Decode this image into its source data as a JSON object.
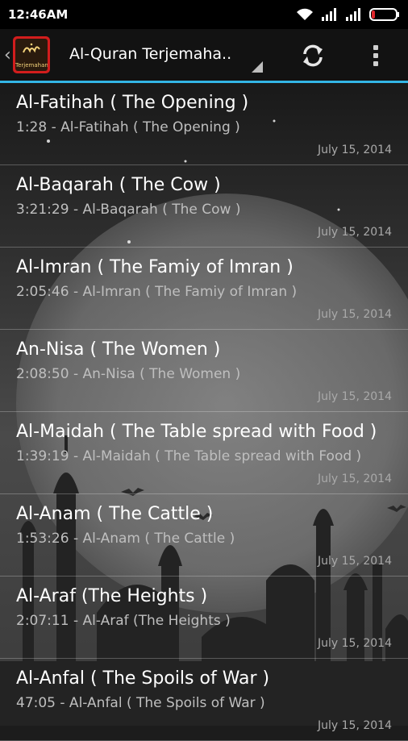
{
  "status_bar": {
    "time": "12:46AM",
    "icons": [
      "wifi-icon",
      "signal-icon",
      "signal-icon-2",
      "battery-icon"
    ]
  },
  "action_bar": {
    "title": "Al-Quran Terjemaha..",
    "app_icon_label": "Terjemahan",
    "accent_color": "#33b5e5"
  },
  "items": [
    {
      "title": "Al-Fatihah ( The Opening )",
      "subtitle": "1:28 - Al-Fatihah ( The Opening )",
      "date": "July 15, 2014"
    },
    {
      "title": "Al-Baqarah ( The Cow )",
      "subtitle": "3:21:29 - Al-Baqarah ( The Cow )",
      "date": "July 15, 2014"
    },
    {
      "title": "Al-Imran ( The Famiy of Imran )",
      "subtitle": "2:05:46 - Al-Imran ( The Famiy of Imran )",
      "date": "July 15, 2014"
    },
    {
      "title": "An-Nisa ( The Women )",
      "subtitle": "2:08:50 - An-Nisa ( The Women )",
      "date": "July 15, 2014"
    },
    {
      "title": "Al-Maidah ( The Table spread with Food )",
      "subtitle": "1:39:19 - Al-Maidah ( The Table spread with Food )",
      "date": "July 15, 2014"
    },
    {
      "title": "Al-Anam ( The Cattle )",
      "subtitle": "1:53:26 - Al-Anam ( The Cattle )",
      "date": "July 15, 2014"
    },
    {
      "title": "Al-Araf (The Heights )",
      "subtitle": "2:07:11 - Al-Araf (The Heights )",
      "date": "July 15, 2014"
    },
    {
      "title": "Al-Anfal ( The Spoils of War )",
      "subtitle": "47:05 - Al-Anfal ( The Spoils of War )",
      "date": "July 15, 2014"
    }
  ]
}
